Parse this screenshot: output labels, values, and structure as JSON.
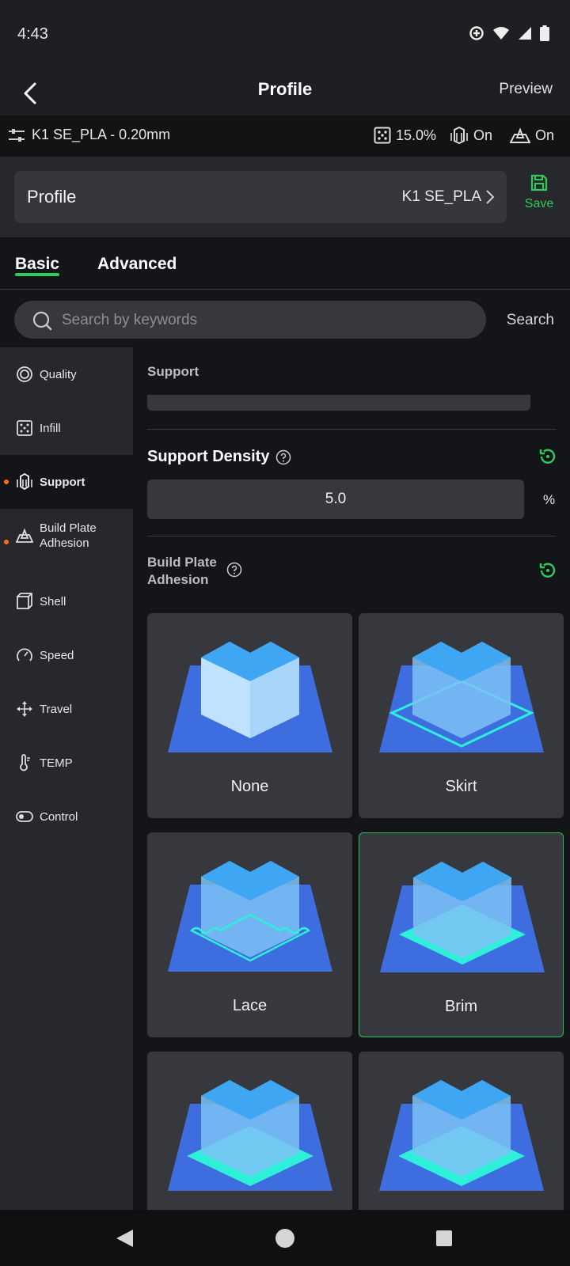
{
  "status_bar": {
    "time": "4:43"
  },
  "header": {
    "title": "Profile",
    "preview_label": "Preview"
  },
  "info_bar": {
    "profile_name": "K1 SE_PLA - 0.20mm",
    "infill": "15.0%",
    "support": "On",
    "adhesion": "On"
  },
  "profile": {
    "label": "Profile",
    "value": "K1 SE_PLA",
    "save_label": "Save"
  },
  "tabs": [
    {
      "label": "Basic",
      "active": true
    },
    {
      "label": "Advanced",
      "active": false
    }
  ],
  "search": {
    "placeholder": "Search by keywords",
    "button_label": "Search"
  },
  "sidebar": {
    "items": [
      {
        "label": "Quality",
        "icon": "quality-icon"
      },
      {
        "label": "Infill",
        "icon": "infill-icon"
      },
      {
        "label": "Support",
        "icon": "support-icon",
        "active": true,
        "modified": true
      },
      {
        "label": "Build Plate\nAdhesion",
        "icon": "adhesion-icon",
        "modified": true
      },
      {
        "label": "Shell",
        "icon": "shell-icon"
      },
      {
        "label": "Speed",
        "icon": "speed-icon"
      },
      {
        "label": "Travel",
        "icon": "travel-icon"
      },
      {
        "label": "TEMP",
        "icon": "temp-icon"
      },
      {
        "label": "Control",
        "icon": "control-icon"
      }
    ]
  },
  "content": {
    "section_title": "Support",
    "support_density": {
      "label": "Support Density",
      "value": "5.0",
      "unit": "%"
    },
    "build_plate_adhesion": {
      "label_line1": "Build Plate",
      "label_line2": "Adhesion",
      "options": [
        {
          "label": "None",
          "selected": false
        },
        {
          "label": "Skirt",
          "selected": false
        },
        {
          "label": "Lace",
          "selected": false
        },
        {
          "label": "Brim",
          "selected": true
        },
        {
          "label": "",
          "selected": false
        },
        {
          "label": "",
          "selected": false
        }
      ]
    }
  },
  "colors": {
    "accent": "#2ecc5a",
    "modified_dot": "#ff6a1a",
    "plate": "#3e6de0",
    "cube": "#3ea6f2",
    "brim": "#2ef0d8"
  }
}
